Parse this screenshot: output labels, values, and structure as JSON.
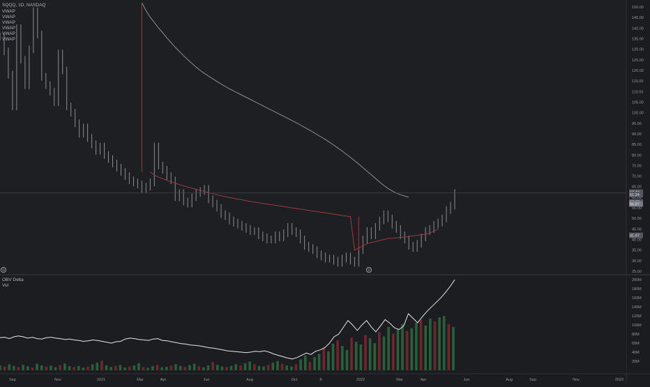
{
  "chart_data": [
    {
      "type": "line",
      "pane": "price",
      "title": "SQQQ, 1D, NASDAQ",
      "legend": [
        "VWAP",
        "VWAP",
        "VWAP",
        "VWAP",
        "VWAP",
        "VWAP"
      ],
      "xlabels": [
        "Sep",
        "Nov",
        "2021",
        "Mar",
        "Apr",
        "Jun",
        "Aug",
        "Oct",
        "8",
        "2022",
        "Mar",
        "Apr",
        "Jun",
        "Aug",
        "Sep",
        "Nov",
        "2023"
      ],
      "yticks": [
        "150.00",
        "145.00",
        "140.00",
        "135.00",
        "130.00",
        "125.00",
        "120.00",
        "115.00",
        "110.00",
        "105.00",
        "100.00",
        "95.00",
        "90.00",
        "85.00",
        "80.00",
        "75.00",
        "70.00",
        "65.00",
        "60.00",
        "55.00",
        "50.00",
        "45.00",
        "40.00",
        "35.00",
        "30.00",
        "25.00"
      ],
      "ylim": [
        25,
        152
      ],
      "price_labels": [
        "62.40",
        "61.24",
        "57.77",
        "56.87",
        "41.97"
      ],
      "markers": [
        "D",
        "D"
      ],
      "series": [
        {
          "values": [
            136,
            129,
            118,
            103,
            140,
            125,
            113,
            130,
            148,
            137,
            117,
            113,
            110,
            105,
            128,
            120,
            103,
            100,
            95,
            90,
            93,
            88,
            85,
            82,
            84,
            80,
            78,
            76,
            74,
            72,
            70,
            68,
            67,
            66,
            64,
            65,
            67,
            84,
            75,
            73,
            70,
            68,
            60,
            62,
            58,
            57,
            60,
            62,
            63,
            64,
            59,
            57,
            55,
            52,
            51,
            49,
            48,
            47,
            46,
            45,
            44,
            44,
            42,
            41,
            40,
            40,
            42,
            41,
            43,
            46,
            44,
            43,
            40,
            37,
            36,
            35,
            33,
            32,
            31,
            31,
            30,
            29,
            31,
            32,
            30,
            29,
            35,
            40,
            44,
            42,
            46,
            49,
            52,
            50,
            47,
            45,
            42,
            40,
            37,
            36,
            38,
            41,
            44,
            45,
            47,
            48,
            50,
            54,
            56,
            62
          ]
        },
        {
          "values": [
            null,
            null,
            null,
            null,
            null,
            null,
            null,
            null,
            null,
            null,
            null,
            null,
            null,
            null,
            null,
            null,
            null,
            null,
            null,
            null,
            null,
            null,
            null,
            null,
            null,
            null,
            null,
            null,
            null,
            null,
            null,
            null,
            null,
            null,
            null,
            null,
            72,
            70.5,
            69.5,
            68.8,
            68,
            67.3,
            66.7,
            66,
            65.4,
            64.8,
            64.3,
            63.8,
            63.2,
            62.7,
            62.2,
            61.7,
            61.2,
            60.7,
            60.3,
            59.9,
            59.5,
            59.1,
            58.8,
            58.4,
            58,
            57.7,
            57.4,
            57.1,
            56.8,
            56.5,
            56.2,
            55.9,
            55.6,
            55.3,
            55,
            54.7,
            54.4,
            54.1,
            53.8,
            53.5,
            53.2,
            52.9,
            52.6,
            52.3,
            52,
            51.7,
            51.4,
            51.1,
            50.8,
            35,
            36,
            37,
            38,
            38.6,
            39,
            39.6,
            40,
            40.5,
            40.6,
            40.8,
            41,
            41.2,
            41.5,
            41.8,
            42,
            42.3,
            42.5,
            43,
            44,
            45
          ]
        },
        {
          "values": [
            null,
            null,
            null,
            null,
            null,
            null,
            null,
            null,
            null,
            null,
            null,
            null,
            null,
            null,
            null,
            null,
            null,
            null,
            null,
            null,
            null,
            null,
            null,
            null,
            null,
            null,
            null,
            null,
            null,
            null,
            null,
            null,
            null,
            null,
            152,
            148.3,
            145.2,
            142.7,
            140.1,
            137.8,
            135.4,
            133.2,
            131,
            129,
            127,
            125.1,
            123.3,
            121.6,
            120,
            118.6,
            117.3,
            116,
            114.8,
            113.6,
            112.4,
            111.3,
            110.3,
            109.3,
            108.3,
            107.3,
            106.3,
            105.3,
            104.3,
            103.3,
            102.3,
            101.3,
            100.3,
            99.3,
            98.3,
            97.3,
            96.3,
            95.3,
            94.2,
            93.1,
            92,
            90.9,
            89.7,
            88.5,
            87.3,
            86,
            84.7,
            83.3,
            81.9,
            80.4,
            78.9,
            77.3,
            75.7,
            74,
            72.3,
            70.6,
            68.9,
            67.2,
            65.6,
            64.2,
            63,
            62,
            61.2,
            60.6,
            60
          ]
        },
        {
          "values": [
            null,
            null,
            null,
            null,
            null,
            null,
            null,
            null,
            null,
            null,
            null,
            null,
            null,
            null,
            null,
            null,
            null,
            null,
            null,
            null,
            null,
            null,
            null,
            null,
            null,
            null,
            null,
            null,
            null,
            null,
            null,
            null,
            null,
            null,
            null,
            null,
            null,
            null,
            null,
            null,
            null,
            null,
            null,
            null,
            null,
            null,
            null,
            null,
            null,
            null,
            null,
            null,
            null,
            null,
            null,
            null,
            null,
            null,
            null,
            null,
            null,
            null,
            null,
            null,
            null,
            null,
            null,
            null,
            null,
            null,
            null,
            null,
            null,
            null,
            null,
            null,
            null,
            null,
            null,
            null,
            null,
            null,
            null,
            null,
            null,
            null,
            null,
            null,
            null,
            null,
            null,
            null,
            null,
            null,
            null,
            null,
            null,
            null,
            null,
            null,
            null,
            null,
            null,
            null,
            null,
            null,
            null,
            null
          ]
        }
      ]
    },
    {
      "type": "bar",
      "pane": "indicator",
      "legend": [
        "OBV Delta",
        "Vol"
      ],
      "yticks": [
        "200M",
        "180M",
        "160M",
        "140M",
        "120M",
        "100M",
        "80M",
        "60M",
        "40M",
        "20M"
      ],
      "ylim": [
        0,
        205
      ],
      "series": [
        {
          "values": [
            72,
            73,
            70,
            74,
            76,
            74,
            71,
            73,
            70,
            69,
            72,
            73,
            71,
            70,
            68,
            69,
            67,
            66,
            64,
            65,
            67,
            66,
            64,
            62,
            60,
            63,
            64,
            69,
            71,
            70,
            68,
            67,
            66,
            69,
            70,
            66,
            65,
            63,
            61,
            59,
            58,
            56,
            55,
            54,
            52,
            50,
            49,
            47,
            45,
            43,
            42,
            41,
            40,
            39,
            40,
            42,
            41,
            43,
            40,
            36,
            33,
            30,
            27,
            25,
            28,
            33,
            38,
            35,
            42,
            45,
            50,
            60,
            74,
            80,
            95,
            110,
            100,
            88,
            100,
            110,
            96,
            85,
            98,
            112,
            104,
            94,
            90,
            98,
            125,
            115,
            105,
            118,
            130,
            140,
            150,
            160,
            172,
            185,
            200
          ]
        },
        {
          "values": [
            18,
            14,
            22,
            16,
            12,
            20,
            15,
            10,
            24,
            18,
            13,
            17,
            11,
            19,
            25,
            15,
            12,
            16,
            10,
            14,
            22,
            28,
            35,
            18,
            12,
            16,
            20,
            10,
            14,
            18,
            26,
            12,
            9,
            15,
            20,
            11,
            13,
            17,
            22,
            16,
            12,
            19,
            24,
            15,
            11,
            18,
            30,
            20,
            14,
            12,
            16,
            22,
            18,
            26,
            32,
            22,
            16,
            14,
            20,
            28,
            34,
            24,
            18,
            14,
            22,
            40,
            55,
            30,
            48,
            60,
            85,
            70,
            98,
            110,
            90,
            75,
            120,
            105,
            95,
            130,
            118,
            100,
            140,
            125,
            160,
            135,
            150,
            170,
            145,
            155,
            175,
            185,
            165,
            190,
            180,
            195,
            200,
            170,
            160
          ]
        }
      ]
    }
  ]
}
